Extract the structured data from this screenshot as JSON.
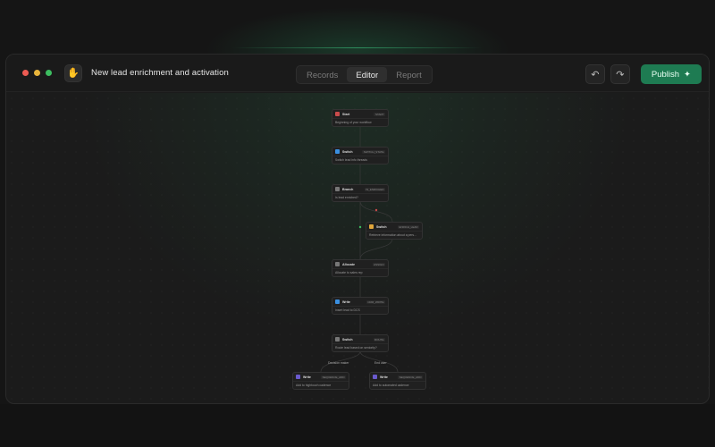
{
  "window": {
    "title": "New lead enrichment and activation"
  },
  "tabs": [
    {
      "label": "Records",
      "active": false
    },
    {
      "label": "Editor",
      "active": true
    },
    {
      "label": "Report",
      "active": false
    }
  ],
  "actions": {
    "publish_label": "Publish"
  },
  "icons": {
    "app": "hand-icon",
    "undo": "undo-icon",
    "redo": "redo-icon",
    "publish": "spark-icon"
  },
  "colors": {
    "accent": "#1e7b52",
    "background": "#151515"
  },
  "nodes": [
    {
      "id": "start",
      "type": "Start",
      "tag": "START",
      "desc": "Beginning of your workflow",
      "icon_color": "#c94b4b"
    },
    {
      "id": "switch1",
      "type": "Switch",
      "tag": "SWITCH_STATE",
      "desc": "Switch lead info threads",
      "icon_color": "#3a8fe0"
    },
    {
      "id": "branch",
      "type": "Branch",
      "tag": "IS_ENRICHED",
      "desc": "Is lead enriched?",
      "icon_color": "#777777"
    },
    {
      "id": "switch2",
      "type": "Switch",
      "tag": "ENRICH_LEAD",
      "desc": "Retrieve information about a pers...",
      "icon_color": "#e0a63a"
    },
    {
      "id": "allocate",
      "type": "Allocate",
      "tag": "ASSIGN",
      "desc": "Allocate to sales rep",
      "icon_color": "#777777"
    },
    {
      "id": "write1",
      "type": "Write",
      "tag": "CRM_WRITE",
      "desc": "Insert lead to DCS",
      "icon_color": "#3a8fe0"
    },
    {
      "id": "switch3",
      "type": "Switch",
      "tag": "ROUTE",
      "desc": "Route lead based on seniority?",
      "icon_color": "#777777"
    },
    {
      "id": "write2",
      "type": "Write",
      "tag": "SEQUENCE_ADD",
      "desc": "Add to hightouch cadence",
      "icon_color": "#6a5acd"
    },
    {
      "id": "write3",
      "type": "Write",
      "tag": "SEQUENCE_ADD",
      "desc": "Add to automated cadence",
      "icon_color": "#6a5acd"
    }
  ],
  "branch_labels": [
    "Decision maker",
    "End user"
  ]
}
